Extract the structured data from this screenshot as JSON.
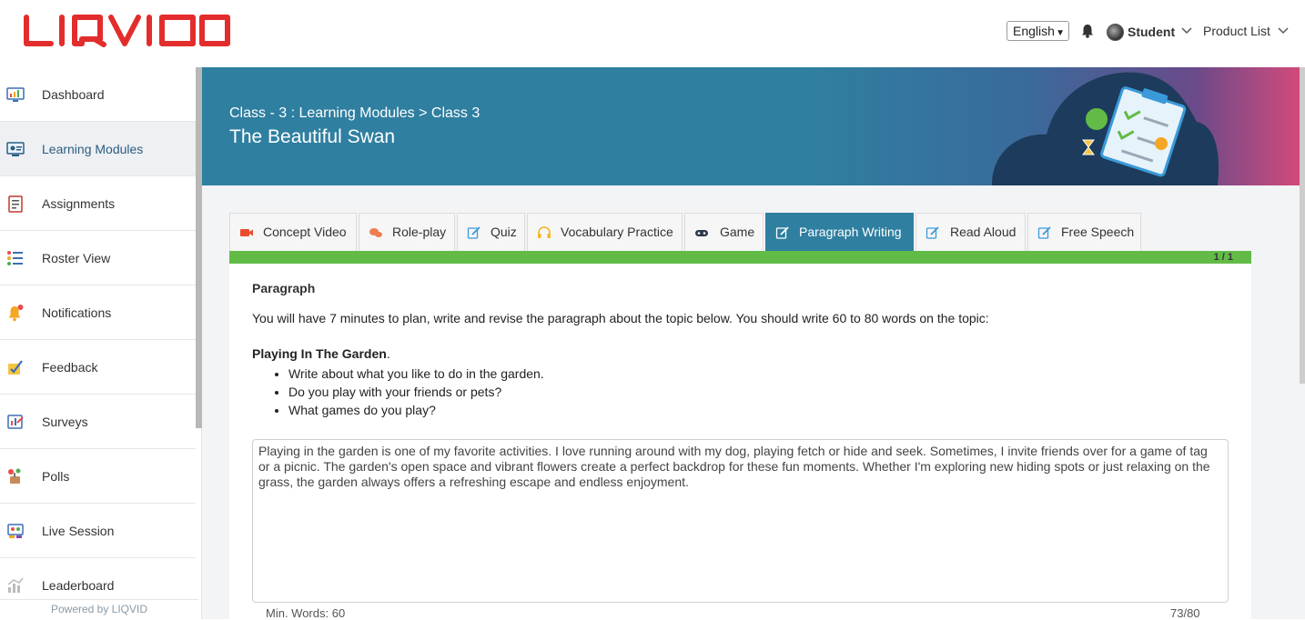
{
  "brand": {
    "logo_text": "LIQVID",
    "logo_color": "#e32d2d",
    "accent": "#2f7fa0",
    "success": "#62bb46"
  },
  "header": {
    "language": "English",
    "user_name": "Student",
    "product_list": "Product List"
  },
  "sidebar": {
    "items": [
      {
        "label": "Dashboard",
        "icon": "dashboard-icon"
      },
      {
        "label": "Learning Modules",
        "icon": "learning-modules-icon",
        "active": true
      },
      {
        "label": "Assignments",
        "icon": "assignments-icon"
      },
      {
        "label": "Roster View",
        "icon": "roster-icon"
      },
      {
        "label": "Notifications",
        "icon": "notifications-icon"
      },
      {
        "label": "Feedback",
        "icon": "feedback-icon"
      },
      {
        "label": "Surveys",
        "icon": "surveys-icon"
      },
      {
        "label": "Polls",
        "icon": "polls-icon"
      },
      {
        "label": "Live Session",
        "icon": "live-session-icon"
      },
      {
        "label": "Leaderboard",
        "icon": "leaderboard-icon"
      }
    ],
    "powered_by": "Powered by LIQVID"
  },
  "banner": {
    "breadcrumb": "Class - 3 : Learning Modules > Class 3",
    "title": "The Beautiful Swan"
  },
  "tabs": [
    {
      "label": "Concept Video",
      "icon": "video-icon"
    },
    {
      "label": "Role-play",
      "icon": "chat-icon"
    },
    {
      "label": "Quiz",
      "icon": "edit-icon"
    },
    {
      "label": "Vocabulary Practice",
      "icon": "headphones-icon"
    },
    {
      "label": "Game",
      "icon": "gamepad-icon"
    },
    {
      "label": "Paragraph Writing",
      "icon": "edit-icon",
      "active": true
    },
    {
      "label": "Read Aloud",
      "icon": "edit-icon"
    },
    {
      "label": "Free Speech",
      "icon": "edit-icon"
    }
  ],
  "progress": {
    "count": "1 / 1",
    "fraction": 1.0
  },
  "task": {
    "heading": "Paragraph",
    "instructions": "You will have 7 minutes to plan, write and revise the paragraph about the topic below. You should write 60 to 80 words on the topic:",
    "topic": "Playing In The Garden",
    "topic_suffix": ".",
    "bullets": [
      "Write about what you like to do in the garden.",
      "Do you play with your friends or pets?",
      "What games do you play?"
    ],
    "answer": "Playing in the garden is one of my favorite activities. I love running around with my dog, playing fetch or hide and seek. Sometimes, I invite friends over for a game of tag or a picnic. The garden's open space and vibrant flowers create a perfect backdrop for these fun moments. Whether I'm exploring new hiding spots or just relaxing on the grass, the garden always offers a refreshing escape and endless enjoyment.",
    "min_words": "Min. Words: 60",
    "word_count": "73/80"
  }
}
